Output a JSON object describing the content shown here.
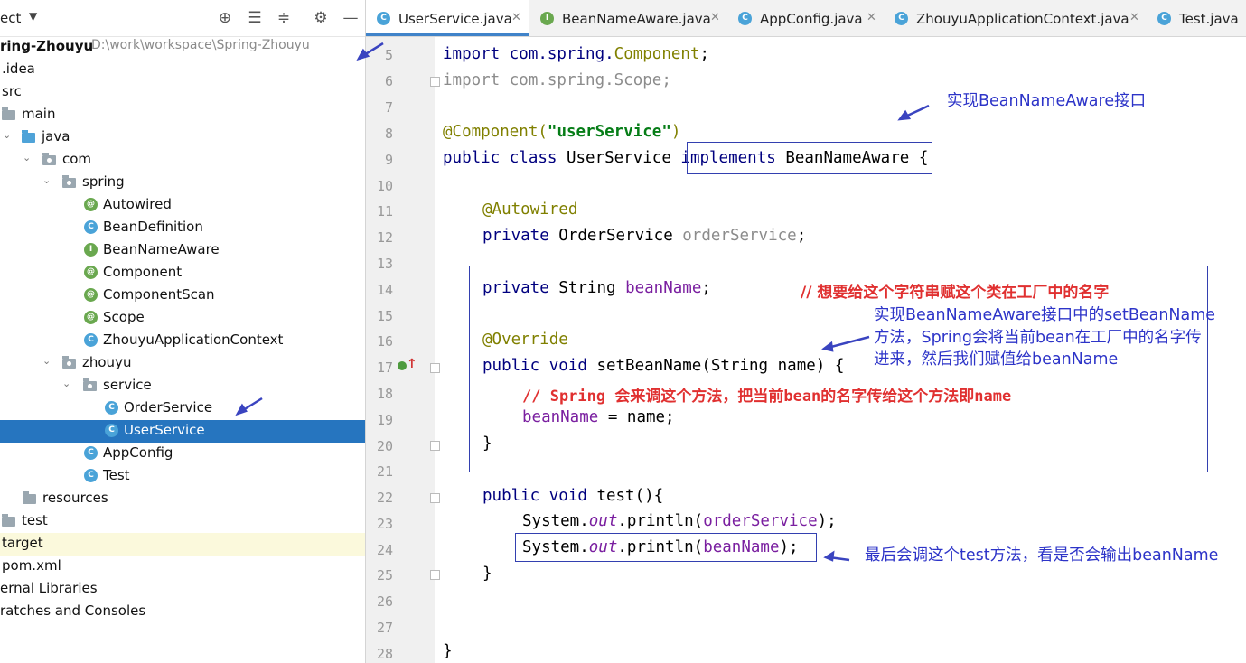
{
  "project_panel": {
    "title": "ect",
    "project_name": "ring-Zhouyu",
    "project_path": "D:\\work\\workspace\\Spring-Zhouyu",
    "tree": [
      {
        "label": ".idea"
      },
      {
        "label": "src"
      },
      {
        "label": "main"
      },
      {
        "label": "java"
      },
      {
        "label": "com"
      },
      {
        "label": "spring"
      },
      {
        "label": "Autowired",
        "kind": "annotation"
      },
      {
        "label": "BeanDefinition",
        "kind": "class"
      },
      {
        "label": "BeanNameAware",
        "kind": "interface"
      },
      {
        "label": "Component",
        "kind": "annotation"
      },
      {
        "label": "ComponentScan",
        "kind": "annotation"
      },
      {
        "label": "Scope",
        "kind": "annotation"
      },
      {
        "label": "ZhouyuApplicationContext",
        "kind": "class"
      },
      {
        "label": "zhouyu"
      },
      {
        "label": "service"
      },
      {
        "label": "OrderService",
        "kind": "class"
      },
      {
        "label": "UserService",
        "kind": "class",
        "selected": true
      },
      {
        "label": "AppConfig",
        "kind": "class"
      },
      {
        "label": "Test",
        "kind": "class"
      },
      {
        "label": "resources"
      },
      {
        "label": "test"
      },
      {
        "label": "target"
      },
      {
        "label": "pom.xml"
      },
      {
        "label": "ernal Libraries"
      },
      {
        "label": "ratches and Consoles"
      }
    ]
  },
  "tabs": [
    {
      "label": "UserService.java",
      "icon": "C",
      "active": true
    },
    {
      "label": "BeanNameAware.java",
      "icon": "I"
    },
    {
      "label": "AppConfig.java",
      "icon": "C"
    },
    {
      "label": "ZhouyuApplicationContext.java",
      "icon": "C"
    },
    {
      "label": "Test.java",
      "icon": "C"
    }
  ],
  "editor": {
    "line_numbers": [
      "5",
      "6",
      "7",
      "8",
      "9",
      "10",
      "11",
      "12",
      "13",
      "14",
      "15",
      "16",
      "17",
      "18",
      "19",
      "20",
      "21",
      "22",
      "23",
      "24",
      "25",
      "26",
      "27",
      "28"
    ],
    "code": {
      "l5_a": "import com.spring.",
      "l5_b": "Component",
      "l5_c": ";",
      "l6": "import com.spring.Scope;",
      "l8_a": "@Component(",
      "l8_b": "\"userService\"",
      "l8_c": ")",
      "l9_a": "public class ",
      "l9_b": "UserService ",
      "l9_c": "implements ",
      "l9_d": "BeanNameAware {",
      "l11": "@Autowired",
      "l12_a": "private ",
      "l12_b": "OrderService ",
      "l12_c": "orderService",
      "l12_d": ";",
      "l14_a": "private ",
      "l14_b": "String ",
      "l14_c": "beanName",
      "l14_d": ";",
      "l16": "@Override",
      "l17_a": "public void ",
      "l17_b": "setBeanName(String name) {",
      "l18": "// Spring 会来调这个方法，把当前bean的名字传给这个方法即name",
      "l19_a": "beanName",
      "l19_b": " = name;",
      "l20": "}",
      "l22_a": "public void ",
      "l22_b": "test(){",
      "l23_a": "System.",
      "l23_b": "out",
      "l23_c": ".println(",
      "l23_d": "orderService",
      "l23_e": ");",
      "l24_a": "System.",
      "l24_b": "out",
      "l24_c": ".println(",
      "l24_d": "beanName",
      "l24_e": ");",
      "l25": "}",
      "l28": "}"
    },
    "inline_comment_14": "// 想要给这个字符串赋这个类在工厂中的名字"
  },
  "annotations": {
    "note1": "实现BeanNameAware接口",
    "note2_l1": "实现BeanNameAware接口中的setBeanName",
    "note2_l2": "方法，Spring会将当前bean在工厂中的名字传",
    "note2_l3": "进来，然后我们赋值给beanName",
    "note3": "最后会调这个test方法，看是否会输出beanName"
  },
  "colors": {
    "keyword": "#00007f",
    "annotation": "#808000",
    "string": "#067d17",
    "field": "#7a1fa0",
    "comment": "#e03030",
    "note_text": "#2d34c8",
    "selection": "#2675bf"
  }
}
